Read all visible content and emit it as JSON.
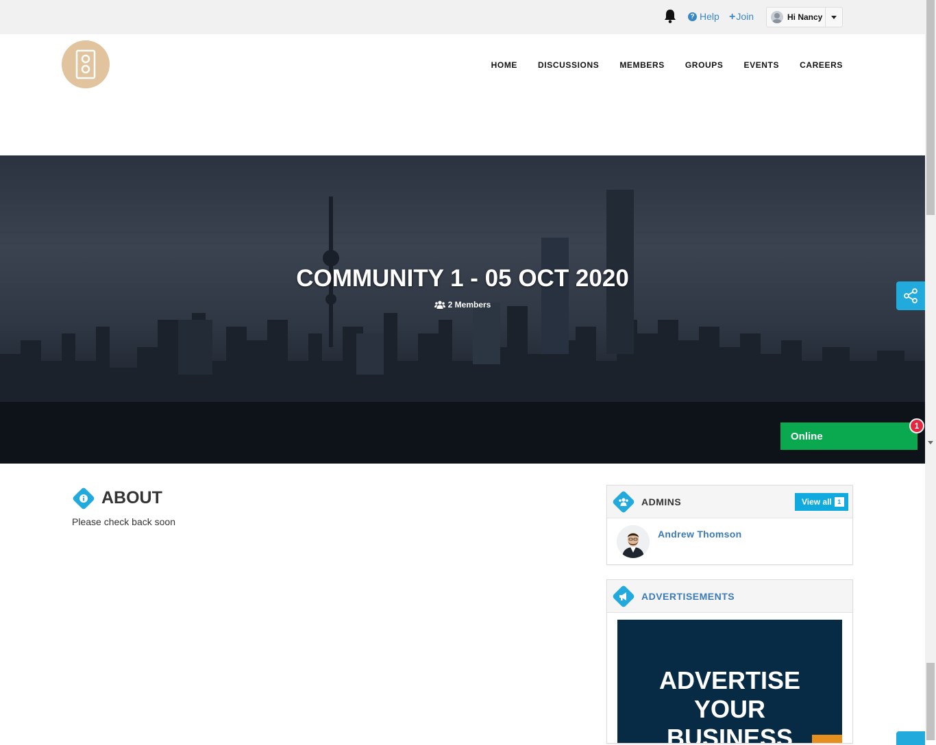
{
  "topbar": {
    "help_label": "Help",
    "join_label": "Join",
    "user_greeting": "Hi Nancy"
  },
  "nav": {
    "items": [
      "HOME",
      "DISCUSSIONS",
      "MEMBERS",
      "GROUPS",
      "EVENTS",
      "CAREERS"
    ]
  },
  "hero": {
    "title": "COMMUNITY 1 - 05 OCT 2020",
    "members": "2 Members"
  },
  "online": {
    "label": "Online",
    "count": "1"
  },
  "about": {
    "title": "ABOUT",
    "text": "Please check back soon"
  },
  "admins": {
    "title": "ADMINS",
    "view_all_label": "View all",
    "view_all_count": "1",
    "list": [
      {
        "name": "Andrew Thomson"
      }
    ]
  },
  "advertisements": {
    "title": "ADVERTISEMENTS",
    "ad_line1": "ADVERTISE",
    "ad_line2": "YOUR",
    "ad_line3": "BUSINESS"
  },
  "colors": {
    "accent": "#22aadd",
    "online": "#0aa84f",
    "badge": "#e5263f",
    "link": "#3a7ab8",
    "logo_bg": "#e1c39d"
  }
}
